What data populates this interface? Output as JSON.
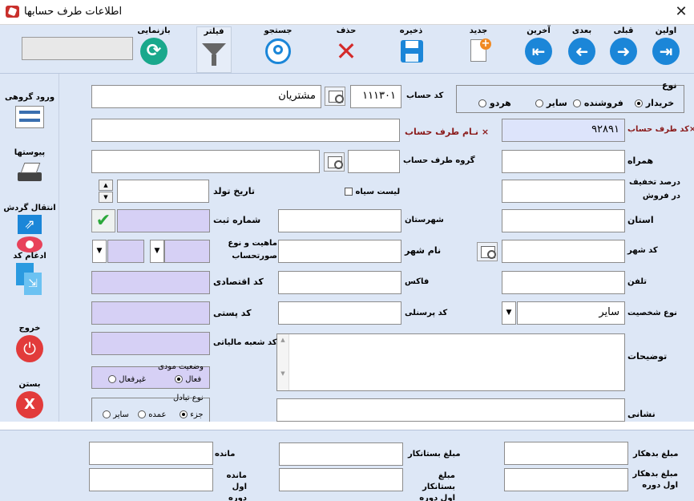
{
  "window": {
    "title": "اطلاعات طرف حسابها",
    "close": "✕"
  },
  "toolbar": {
    "first": "اولین",
    "prev": "قبلی",
    "next": "بعدی",
    "last": "آخرین",
    "new": "جدید",
    "save": "ذخیره",
    "delete": "حذف",
    "search": "جستجو",
    "filter": "فیلتر",
    "refresh": "بازنمایی"
  },
  "sidebar": {
    "group_entry": "ورود گروهی",
    "attachments": "پیوستها",
    "transfer": "انتقال گردش",
    "merge": "ادغام کد",
    "exit": "خروج",
    "close": "بستن"
  },
  "type_group": {
    "title": "نوع",
    "buyer": "خریدار",
    "seller": "فروشنده",
    "other": "سایر",
    "both": "هردو"
  },
  "fields": {
    "account_code_label": "کد حساب",
    "account_code_value": "۱۱۱۳۰۱",
    "account_name": "مشتریان",
    "party_code_label": "×کد طرف حساب",
    "party_code_value": "۹۲۸۹۱",
    "party_name_label": "نـام طرف حساب",
    "party_name_x": "×",
    "group_label": "گروه طرف حساب",
    "mobile_label": "همراه",
    "discount_label": "درصد تخفیف در فروش",
    "blacklist_label": "لیست سیاه",
    "birth_label": "تاریخ تولد",
    "province_label": "استان",
    "county_label": "شهرستان",
    "reg_no_label": "شماره ثبت",
    "city_code_label": "کد شهر",
    "city_name_label": "نام شهر",
    "nature_label": "ماهیت و نوع صورتحساب",
    "phone_label": "تلفن",
    "fax_label": "فاکس",
    "economic_label": "کد اقتصادی",
    "person_type_label": "نوع شخصیت",
    "person_type_value": "سایر",
    "personnel_label": "کد پرسنلی",
    "postal_label": "کد پستی",
    "desc_label": "توضیحات",
    "tax_branch_label": "کد شعبه مالیاتی",
    "address_label": "نشانی"
  },
  "taxpayer": {
    "title": "وضعیت مودی",
    "active": "فعال",
    "inactive": "غیرفعال"
  },
  "exchange": {
    "title": "نوع تبادل",
    "part": "جزء",
    "wholesale": "عمده",
    "other": "سایر"
  },
  "bottom": {
    "debit_label": "مبلغ بدهکار",
    "credit_label": "مبلغ بستانکار",
    "balance_label": "مانده",
    "debit_open_label": "مبلغ بدهکار اول دوره",
    "credit_open_label": "مبلغ بستانکار اول دوره",
    "balance_open_label": "مانده اول دوره"
  },
  "colors": {
    "toolbar_bg": "#dde7f6",
    "readonly_bg": "#d6d0f5",
    "accent_blue": "#1b86d8",
    "exit_red": "#e23b3b"
  }
}
